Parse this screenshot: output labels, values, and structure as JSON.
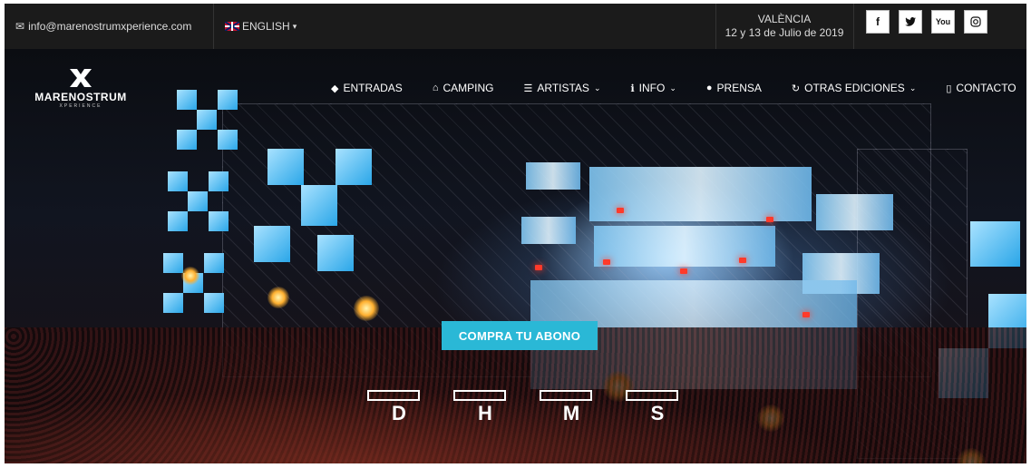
{
  "topbar": {
    "email": "info@marenostrumxperience.com",
    "language": "ENGLISH",
    "city": "VALÈNCIA",
    "dates": "12 y 13 de Julio de 2019",
    "social": [
      {
        "icon": "facebook-icon",
        "glyph": "f"
      },
      {
        "icon": "twitter-icon",
        "glyph": "🐦"
      },
      {
        "icon": "youtube-icon",
        "glyph": "▶"
      },
      {
        "icon": "instagram-icon",
        "glyph": "◎"
      }
    ]
  },
  "logo": {
    "name": "MARENOSTRUM",
    "sub": "XPERIENCE"
  },
  "menu": [
    {
      "label": "ENTRADAS",
      "icon": "ticket-icon",
      "glyph": "◆",
      "dropdown": false
    },
    {
      "label": "CAMPING",
      "icon": "home-icon",
      "glyph": "⌂",
      "dropdown": false
    },
    {
      "label": "ARTISTAS",
      "icon": "list-icon",
      "glyph": "☰",
      "dropdown": true
    },
    {
      "label": "INFO",
      "icon": "info-icon",
      "glyph": "ℹ",
      "dropdown": true
    },
    {
      "label": "PRENSA",
      "icon": "user-icon",
      "glyph": "●",
      "dropdown": false
    },
    {
      "label": "OTRAS EDICIONES",
      "icon": "refresh-icon",
      "glyph": "↻",
      "dropdown": true
    },
    {
      "label": "CONTACTO",
      "icon": "phone-icon",
      "glyph": "▯",
      "dropdown": false
    }
  ],
  "cta": {
    "label": "COMPRA TU ABONO",
    "color": "#2ab8d6"
  },
  "countdown": [
    "D",
    "H",
    "M",
    "S"
  ]
}
